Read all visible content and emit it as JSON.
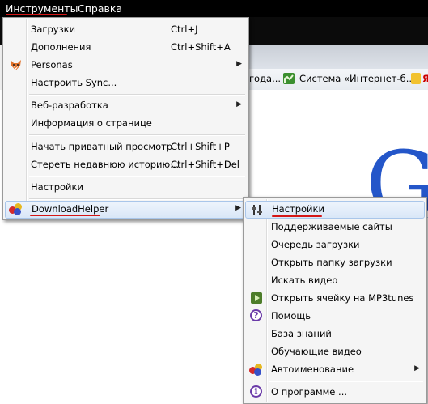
{
  "menubar": {
    "tools": "Инструменты",
    "help": "Справка"
  },
  "bookmarks": [
    {
      "label": "года..."
    },
    {
      "label": "Система «Интернет-б..."
    },
    {
      "label": "Я"
    }
  ],
  "main_menu": {
    "downloads": {
      "label": "Загрузки",
      "shortcut": "Ctrl+J"
    },
    "addons": {
      "label": "Дополнения",
      "shortcut": "Ctrl+Shift+A"
    },
    "personas": {
      "label": "Personas"
    },
    "sync": {
      "label": "Настроить Sync..."
    },
    "webdev": {
      "label": "Веб-разработка"
    },
    "pageinfo": {
      "label": "Информация о странице"
    },
    "private": {
      "label": "Начать приватный просмотр",
      "shortcut": "Ctrl+Shift+P"
    },
    "clearhistory": {
      "label": "Стереть недавнюю историю...",
      "shortcut": "Ctrl+Shift+Del"
    },
    "settings": {
      "label": "Настройки"
    },
    "downloadhelper": {
      "label": "DownloadHelper"
    }
  },
  "sub_menu": {
    "settings": "Настройки",
    "supported_sites": "Поддерживаемые сайты",
    "download_queue": "Очередь загрузки",
    "open_folder": "Открыть папку загрузки",
    "search_video": "Искать видео",
    "mp3tunes": "Открыть ячейку на MP3tunes",
    "help": "Помощь",
    "knowledge": "База знаний",
    "training": "Обучающие видео",
    "autonaming": "Автоименование",
    "about": "О программе ..."
  },
  "colors": {
    "highlight_underline": "#d41616",
    "google_blue": "#2456c9"
  }
}
